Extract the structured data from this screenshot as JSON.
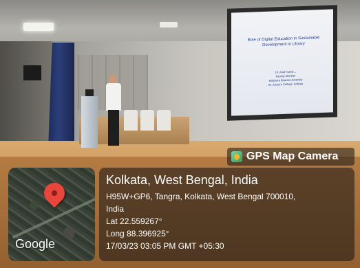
{
  "slide": {
    "title": "Role of Digital Education in Sustainable Development in Library",
    "body_lines": [
      "Dr. Anal Kumar...",
      "Faculty Member",
      "Rabindra Bharati University",
      "St. Xavier's College, Kolkata"
    ]
  },
  "gps_badge": {
    "title": "GPS Map Camera",
    "icon": "gps-map-camera-icon"
  },
  "map": {
    "logo": "Google",
    "pin_icon": "location-pin-icon",
    "pin_color": "#e8453c"
  },
  "location": {
    "city": "Kolkata, West Bengal, India",
    "address_line1": "H95W+GP6, Tangra, Kolkata, West Bengal 700010,",
    "address_line2": "India",
    "lat": "Lat 22.559267°",
    "long": "Long 88.396925°",
    "timestamp": "17/03/23 03:05 PM GMT +05:30"
  }
}
